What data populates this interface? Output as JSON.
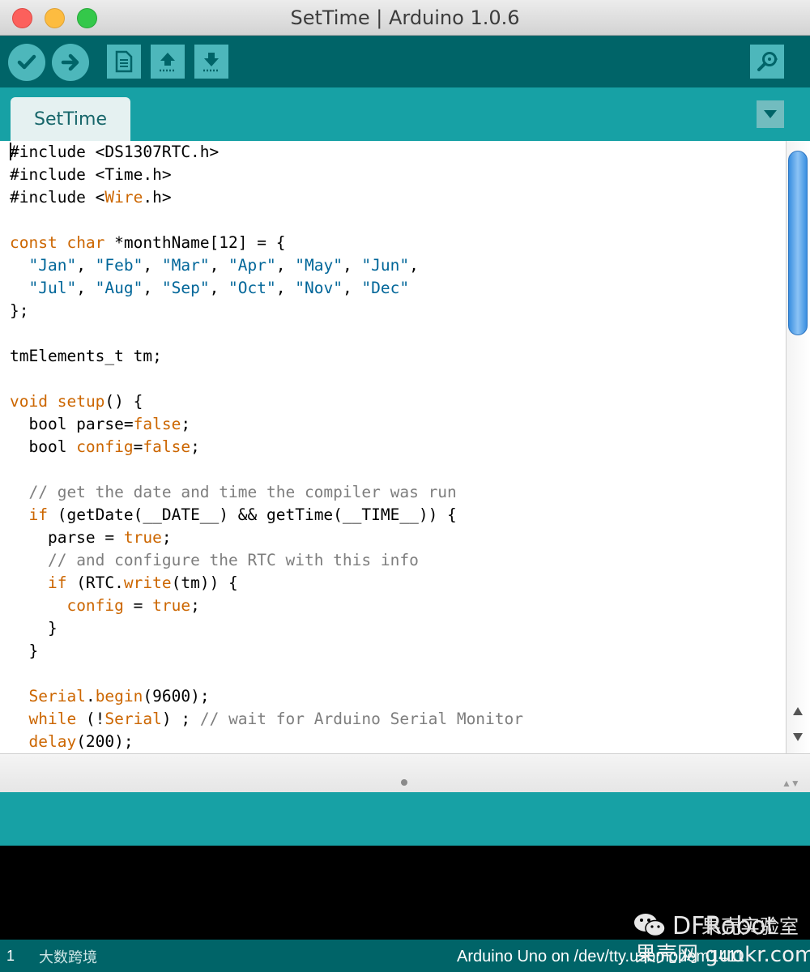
{
  "window": {
    "title": "SetTime | Arduino 1.0.6"
  },
  "toolbar": {
    "buttons": [
      {
        "name": "verify",
        "icon": "checkmark-icon"
      },
      {
        "name": "upload",
        "icon": "arrow-right-icon"
      },
      {
        "name": "new",
        "icon": "document-icon"
      },
      {
        "name": "open",
        "icon": "arrow-up-icon"
      },
      {
        "name": "save",
        "icon": "arrow-down-icon"
      },
      {
        "name": "serial-monitor",
        "icon": "magnifier-icon"
      }
    ]
  },
  "tabs": [
    {
      "label": "SetTime",
      "active": true
    }
  ],
  "editor": {
    "lines": [
      [
        [
          "t",
          "#include <DS1307RTC.h>"
        ]
      ],
      [
        [
          "t",
          "#include <Time.h>"
        ]
      ],
      [
        [
          "t",
          "#include <"
        ],
        [
          "kw",
          "Wire"
        ],
        [
          "t",
          ".h>"
        ]
      ],
      [],
      [
        [
          "kw",
          "const"
        ],
        [
          "t",
          " "
        ],
        [
          "kw",
          "char"
        ],
        [
          "t",
          " *monthName[12] = {"
        ]
      ],
      [
        [
          "t",
          "  "
        ],
        [
          "str",
          "\"Jan\""
        ],
        [
          "t",
          ", "
        ],
        [
          "str",
          "\"Feb\""
        ],
        [
          "t",
          ", "
        ],
        [
          "str",
          "\"Mar\""
        ],
        [
          "t",
          ", "
        ],
        [
          "str",
          "\"Apr\""
        ],
        [
          "t",
          ", "
        ],
        [
          "str",
          "\"May\""
        ],
        [
          "t",
          ", "
        ],
        [
          "str",
          "\"Jun\""
        ],
        [
          "t",
          ","
        ]
      ],
      [
        [
          "t",
          "  "
        ],
        [
          "str",
          "\"Jul\""
        ],
        [
          "t",
          ", "
        ],
        [
          "str",
          "\"Aug\""
        ],
        [
          "t",
          ", "
        ],
        [
          "str",
          "\"Sep\""
        ],
        [
          "t",
          ", "
        ],
        [
          "str",
          "\"Oct\""
        ],
        [
          "t",
          ", "
        ],
        [
          "str",
          "\"Nov\""
        ],
        [
          "t",
          ", "
        ],
        [
          "str",
          "\"Dec\""
        ]
      ],
      [
        [
          "t",
          "};"
        ]
      ],
      [],
      [
        [
          "t",
          "tmElements_t tm;"
        ]
      ],
      [],
      [
        [
          "kw",
          "void"
        ],
        [
          "t",
          " "
        ],
        [
          "kw",
          "setup"
        ],
        [
          "t",
          "() {"
        ]
      ],
      [
        [
          "t",
          "  bool parse="
        ],
        [
          "kw",
          "false"
        ],
        [
          "t",
          ";"
        ]
      ],
      [
        [
          "t",
          "  bool "
        ],
        [
          "kw",
          "config"
        ],
        [
          "t",
          "="
        ],
        [
          "kw",
          "false"
        ],
        [
          "t",
          ";"
        ]
      ],
      [],
      [
        [
          "t",
          "  "
        ],
        [
          "cm",
          "// get the date and time the compiler was run"
        ]
      ],
      [
        [
          "t",
          "  "
        ],
        [
          "kw",
          "if"
        ],
        [
          "t",
          " (getDate(__DATE__) && getTime(__TIME__)) {"
        ]
      ],
      [
        [
          "t",
          "    parse = "
        ],
        [
          "kw",
          "true"
        ],
        [
          "t",
          ";"
        ]
      ],
      [
        [
          "t",
          "    "
        ],
        [
          "cm",
          "// and configure the RTC with this info"
        ]
      ],
      [
        [
          "t",
          "    "
        ],
        [
          "kw",
          "if"
        ],
        [
          "t",
          " (RTC."
        ],
        [
          "kw",
          "write"
        ],
        [
          "t",
          "(tm)) {"
        ]
      ],
      [
        [
          "t",
          "      "
        ],
        [
          "kw",
          "config"
        ],
        [
          "t",
          " = "
        ],
        [
          "kw",
          "true"
        ],
        [
          "t",
          ";"
        ]
      ],
      [
        [
          "t",
          "    }"
        ]
      ],
      [
        [
          "t",
          "  }"
        ]
      ],
      [],
      [
        [
          "t",
          "  "
        ],
        [
          "kw",
          "Serial"
        ],
        [
          "t",
          "."
        ],
        [
          "kw",
          "begin"
        ],
        [
          "t",
          "(9600);"
        ]
      ],
      [
        [
          "t",
          "  "
        ],
        [
          "kw",
          "while"
        ],
        [
          "t",
          " (!"
        ],
        [
          "kw",
          "Serial"
        ],
        [
          "t",
          ") ; "
        ],
        [
          "cm",
          "// wait for Arduino Serial Monitor"
        ]
      ],
      [
        [
          "t",
          "  "
        ],
        [
          "kw",
          "delay"
        ],
        [
          "t",
          "(200);"
        ]
      ]
    ]
  },
  "status": {
    "line_number": "1",
    "board": "Arduino Uno on /dev/tty.usbmodem1411"
  },
  "watermarks": {
    "top": "果壳实验室",
    "brand": "DFRobot",
    "site": "果壳网 guokr.com",
    "bottom_left": "大数跨境"
  },
  "colors": {
    "toolbar": "#006468",
    "tabstrip": "#17a1a5",
    "keyword": "#cc6600",
    "string": "#006699",
    "comment": "#7e7e7e"
  }
}
